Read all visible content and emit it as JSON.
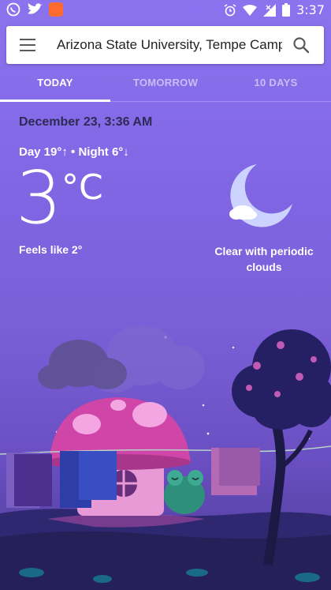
{
  "status_bar": {
    "time": "3:37",
    "left_icons": [
      "whatsapp-icon",
      "twitter-icon",
      "app-icon"
    ],
    "right_icons": [
      "alarm-icon",
      "wifi-icon",
      "signal-icon",
      "battery-icon"
    ]
  },
  "search": {
    "location": "Arizona State University, Tempe Camp"
  },
  "tabs": [
    {
      "label": "TODAY",
      "active": true
    },
    {
      "label": "TOMORROW",
      "active": false
    },
    {
      "label": "10 DAYS",
      "active": false
    }
  ],
  "weather": {
    "date": "December 23, 3:36 AM",
    "day_night": "Day 19°↑ • Night 6°↓",
    "temperature": "3",
    "unit": "°C",
    "feels_like": "Feels like 2°",
    "condition_line1": "Clear with periodic",
    "condition_line2": "clouds",
    "condition_icon": "moon-cloud-icon"
  },
  "colors": {
    "background": "#8065e2",
    "date_text": "#2d2a55"
  }
}
